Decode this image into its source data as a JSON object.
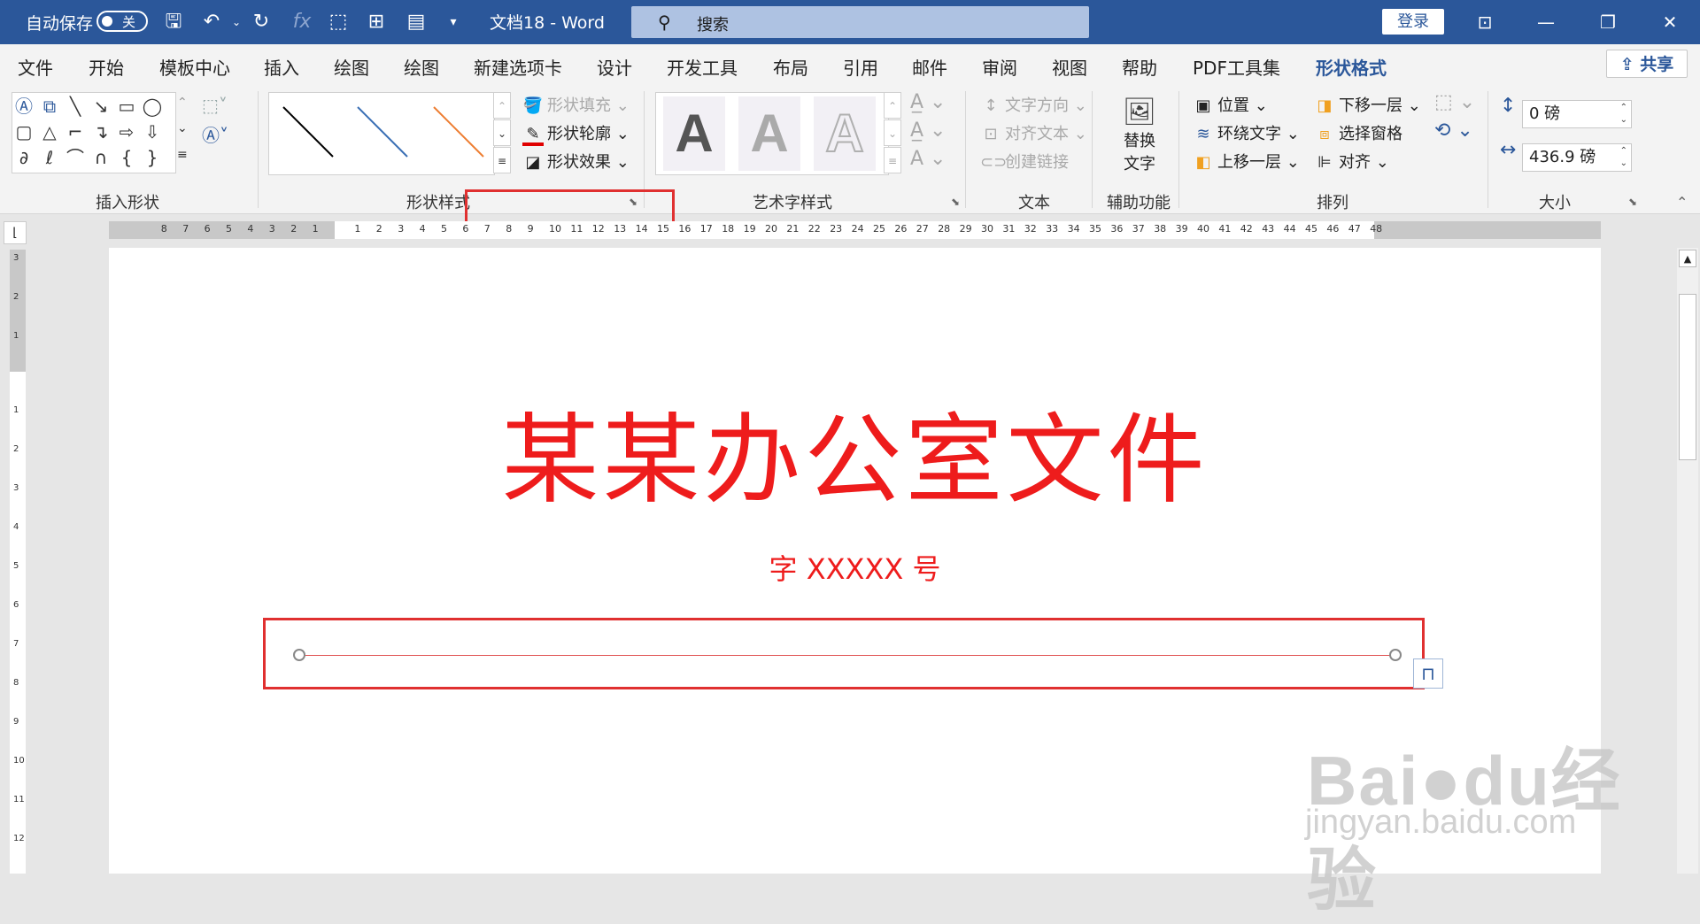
{
  "titlebar": {
    "autosave_label": "自动保存",
    "autosave_state": "关",
    "doc_title": "文档18  -  Word",
    "search_placeholder": "搜索",
    "login_label": "登录"
  },
  "tabs": [
    {
      "label": "文件"
    },
    {
      "label": "开始"
    },
    {
      "label": "模板中心"
    },
    {
      "label": "插入"
    },
    {
      "label": "绘图"
    },
    {
      "label": "绘图"
    },
    {
      "label": "新建选项卡"
    },
    {
      "label": "设计"
    },
    {
      "label": "开发工具"
    },
    {
      "label": "布局"
    },
    {
      "label": "引用"
    },
    {
      "label": "邮件"
    },
    {
      "label": "审阅"
    },
    {
      "label": "视图"
    },
    {
      "label": "帮助"
    },
    {
      "label": "PDF工具集"
    },
    {
      "label": "形状格式"
    }
  ],
  "share_label": "共享",
  "ribbon": {
    "groups": {
      "insert_shapes": "插入形状",
      "shape_styles": "形状样式",
      "wordart_styles": "艺术字样式",
      "text": "文本",
      "accessibility": "辅助功能",
      "arrange": "排列",
      "size": "大小"
    },
    "shape_fill": "形状填充",
    "shape_outline": "形状轮廓",
    "shape_effects": "形状效果",
    "text_direction": "文字方向",
    "align_text": "对齐文本",
    "create_link": "创建链接",
    "alt_text_line1": "替换",
    "alt_text_line2": "文字",
    "position": "位置",
    "wrap_text": "环绕文字",
    "bring_forward": "上移一层",
    "send_backward": "下移一层",
    "selection_pane": "选择窗格",
    "align": "对齐",
    "height_value": "0 磅",
    "width_value": "436.9 磅",
    "wordart_letter": "A"
  },
  "ruler": {
    "left_numbers": [
      "8",
      "7",
      "6",
      "5",
      "4",
      "3",
      "2",
      "1"
    ],
    "right_numbers": [
      "1",
      "2",
      "3",
      "4",
      "5",
      "6",
      "7",
      "8",
      "9",
      "10",
      "11",
      "12",
      "13",
      "14",
      "15",
      "16",
      "17",
      "18",
      "19",
      "20",
      "21",
      "22",
      "23",
      "24",
      "25",
      "26",
      "27",
      "28",
      "29",
      "30",
      "31",
      "32",
      "33",
      "34",
      "35",
      "36",
      "37",
      "38",
      "39",
      "40",
      "41",
      "42",
      "43",
      "44",
      "45",
      "46",
      "47",
      "48"
    ],
    "v_top_numbers": [
      "3",
      "2",
      "1"
    ],
    "v_numbers": [
      "1",
      "2",
      "3",
      "4",
      "5",
      "6",
      "7",
      "8",
      "9",
      "10",
      "11",
      "12"
    ]
  },
  "document": {
    "heading": "某某办公室文件",
    "subheading": "字 XXXXX 号",
    "heading_color": "#ee1c1c"
  },
  "watermark": {
    "brand": "Bai●du经验",
    "url": "jingyan.baidu.com"
  },
  "colors": {
    "titlebar": "#2b579a",
    "accent": "#2b579a",
    "highlight": "#e03030"
  }
}
